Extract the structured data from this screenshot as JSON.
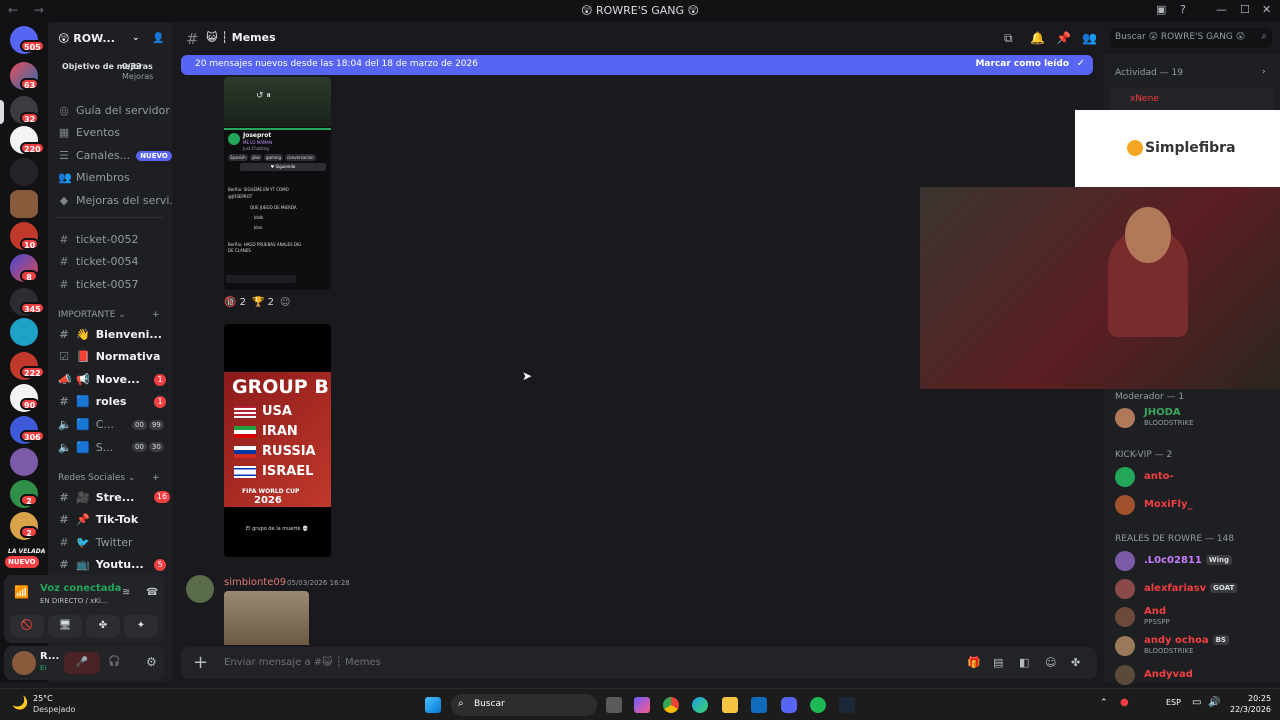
{
  "window": {
    "title": "😲 ROWRE'S GANG 😲",
    "nav": "← →"
  },
  "server": {
    "name": "😲 ROW...",
    "boost_goal": "Objetivo de mejoras",
    "boost_count": "0/33",
    "boost_label": "Mejoras",
    "nav_items": [
      {
        "label": "Guía del servidor",
        "icon": "compass-icon"
      },
      {
        "label": "Eventos",
        "icon": "calendar-icon"
      },
      {
        "label": "Canales...",
        "icon": "list-icon",
        "badge": "NUEVO"
      },
      {
        "label": "Miembros",
        "icon": "people-icon"
      },
      {
        "label": "Mejoras del servi...",
        "icon": "boost-icon"
      }
    ],
    "tickets": [
      "ticket-0052",
      "ticket-0054",
      "ticket-0057"
    ],
    "cat_importante": "IMPORTANTE",
    "importante_channels": [
      {
        "label": "Bienveni...",
        "emoji": "👋",
        "bold": true
      },
      {
        "label": "Normativa",
        "emoji": "📕",
        "bold": true
      },
      {
        "label": "Nove...",
        "emoji": "📢",
        "bold": true,
        "badge": "1"
      },
      {
        "label": "roles",
        "emoji": "🟦",
        "bold": true,
        "badge": "1"
      },
      {
        "label": "C...",
        "emoji": "🟦",
        "bold": false,
        "pair": [
          "00",
          "99"
        ]
      },
      {
        "label": "S...",
        "emoji": "🟦",
        "bold": false,
        "pair": [
          "00",
          "30"
        ]
      }
    ],
    "cat_redes": "Redes Sociales",
    "redes_channels": [
      {
        "label": "Stre...",
        "emoji": "🎥",
        "bold": true,
        "badge": "16"
      },
      {
        "label": "Tik-Tok",
        "emoji": "📌",
        "bold": true
      },
      {
        "label": "Twitter",
        "emoji": "🐦",
        "bold": false
      },
      {
        "label": "Youtu...",
        "emoji": "📺",
        "bold": true,
        "badge": "5"
      }
    ]
  },
  "voice": {
    "status": "Voz conectada",
    "sub": "EN DIRECTO / xKi..."
  },
  "user": {
    "name": "R...",
    "status": "Ei"
  },
  "rail": {
    "badges": [
      "505",
      "63",
      "32",
      "220",
      "10",
      "8",
      "345",
      "222",
      "90",
      "306",
      "2",
      "2"
    ],
    "nuevo_label": "NUEVO",
    "velada_label": "LA VELADA"
  },
  "channel": {
    "name": "😺 ┆ Memes",
    "new_messages": "20 mensajes nuevos desde las 18:04 del 18 de marzo de 2026",
    "mark_read": "Marcar como leído",
    "search_placeholder": "Buscar 😲 ROWRE'S GANG 😲"
  },
  "messages": {
    "embed_user": "Joseprot",
    "embed_line": "ME LO MAMAN",
    "embed_game": "Just Chatting",
    "embed_tags": [
      "Spanish",
      "joke",
      "gaming",
      "conversacion"
    ],
    "embed_follow": "♥ Siguiendo",
    "embed_chat": [
      "@JOSEPROT",
      "BerRix: SIGUEME EN YT COMO",
      "QUE JUEGO DE MIERDA",
      "klalk",
      "klan",
      "BerRix: HAGO PRUEBAS ANALES DIG",
      "DE CLANES"
    ],
    "reactions": [
      {
        "emoji": "🔞",
        "count": "2"
      },
      {
        "emoji": "🏆",
        "count": "2"
      }
    ],
    "group_title": "GROUP B",
    "group_countries": [
      "USA",
      "IRAN",
      "RUSSIA",
      "ISRAEL"
    ],
    "group_footer": "FIFA WORLD CUP",
    "group_year": "2026",
    "group_caption": "El grupo de la muerte 💀",
    "author": "simbionte09",
    "timestamp": "05/03/2026 16:28",
    "composer_placeholder": "Enviar mensaje a #😺 ┆ Memes"
  },
  "overlay": {
    "brand": "Simplefibra"
  },
  "members": {
    "activity": "Actividad — 19",
    "activity_user": "xNene",
    "moderador": "Moderador — 1",
    "mod_list": [
      {
        "name": "JHODA",
        "sub": "BLOODSTRIKE",
        "color": "#3ba55c"
      }
    ],
    "kickvip": "KICK-VIP — 2",
    "vip_list": [
      {
        "name": "anto-",
        "sub": "",
        "color": "#f23f42"
      },
      {
        "name": "MoxiFly_",
        "sub": "",
        "color": "#f23f42"
      }
    ],
    "reales": "REALES DE ROWRE — 148",
    "reales_list": [
      {
        "name": ".L0c02811",
        "tag": "Wing",
        "sub": "",
        "color": "#c77dff"
      },
      {
        "name": "alexfariasv",
        "tag": "GOAT",
        "sub": "",
        "color": "#f23f42"
      },
      {
        "name": "And",
        "tag": "",
        "sub": "PPSSPP",
        "color": "#f23f42"
      },
      {
        "name": "andy ochoa",
        "tag": "BS",
        "sub": "BLOODSTRIKE",
        "color": "#f23f42"
      },
      {
        "name": "Andyvad",
        "tag": "",
        "sub": "",
        "color": "#f23f42"
      }
    ]
  },
  "taskbar": {
    "weather_temp": "25°C",
    "weather_desc": "Despejado",
    "search": "Buscar",
    "lang": "ESP",
    "time": "20:25",
    "date": "22/3/2026"
  }
}
